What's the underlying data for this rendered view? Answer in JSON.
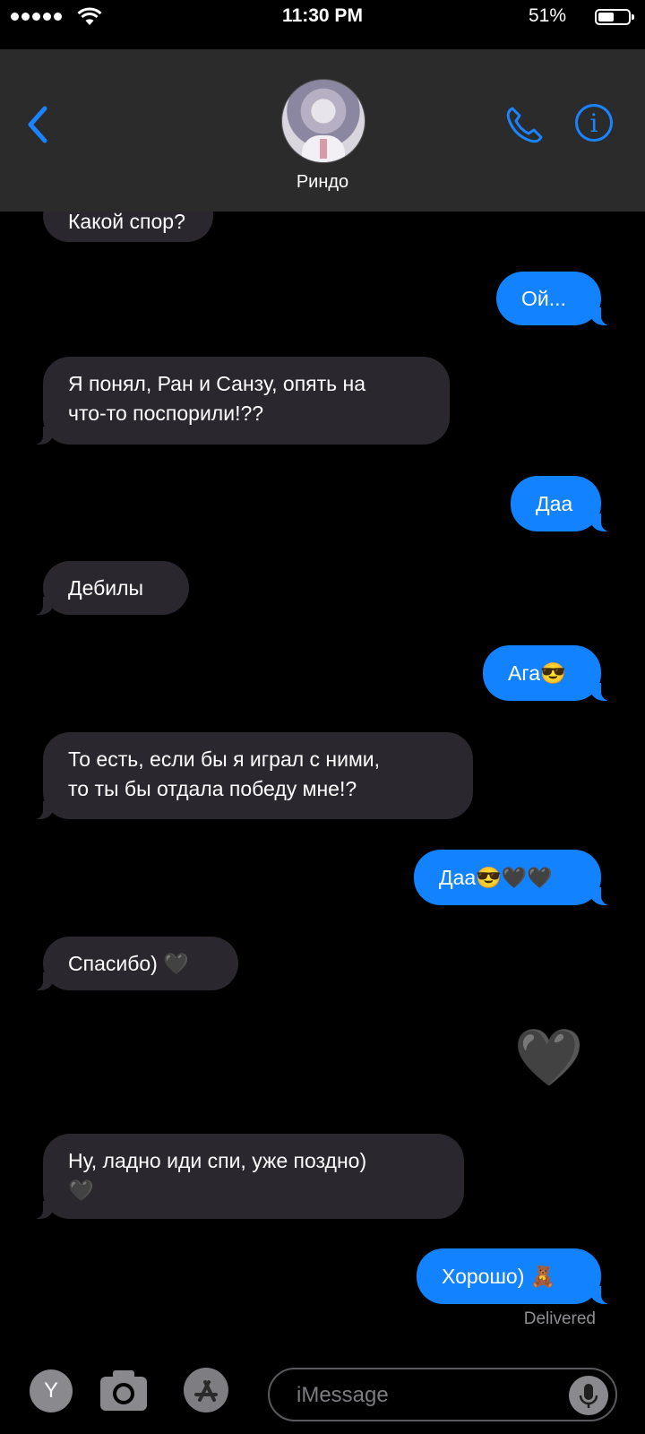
{
  "status_bar": {
    "time": "11:30 PM",
    "battery_percent": "51%"
  },
  "header": {
    "contact_name": "Риндо"
  },
  "messages": [
    {
      "dir": "in",
      "text": "Какой спор?"
    },
    {
      "dir": "out",
      "text": "Ой..."
    },
    {
      "dir": "in",
      "text": "Я понял, Ран и Санзу, опять на",
      "text2": "что-то поспорили!??"
    },
    {
      "dir": "out",
      "text": "Даа"
    },
    {
      "dir": "in",
      "text": "Дебилы"
    },
    {
      "dir": "out",
      "text": "Ага😎"
    },
    {
      "dir": "in",
      "text": "То есть, если бы я играл с ними,",
      "text2": "то ты бы отдала победу мне!?"
    },
    {
      "dir": "out",
      "text": "Даа😎🖤🖤"
    },
    {
      "dir": "in",
      "text": "Спасибо) 🖤"
    },
    {
      "dir": "out",
      "text": "🖤"
    },
    {
      "dir": "in",
      "text": "Ну, ладно иди спи, уже поздно)",
      "text2": "🖤"
    },
    {
      "dir": "out",
      "text": "Хорошо) 🧸"
    }
  ],
  "delivered_label": "Delivered",
  "composer": {
    "app_letter": "Y",
    "placeholder": "iMessage"
  },
  "colors": {
    "accent": "#1a84ff",
    "outgoing": "#1382fe",
    "incoming": "#2a282e"
  }
}
